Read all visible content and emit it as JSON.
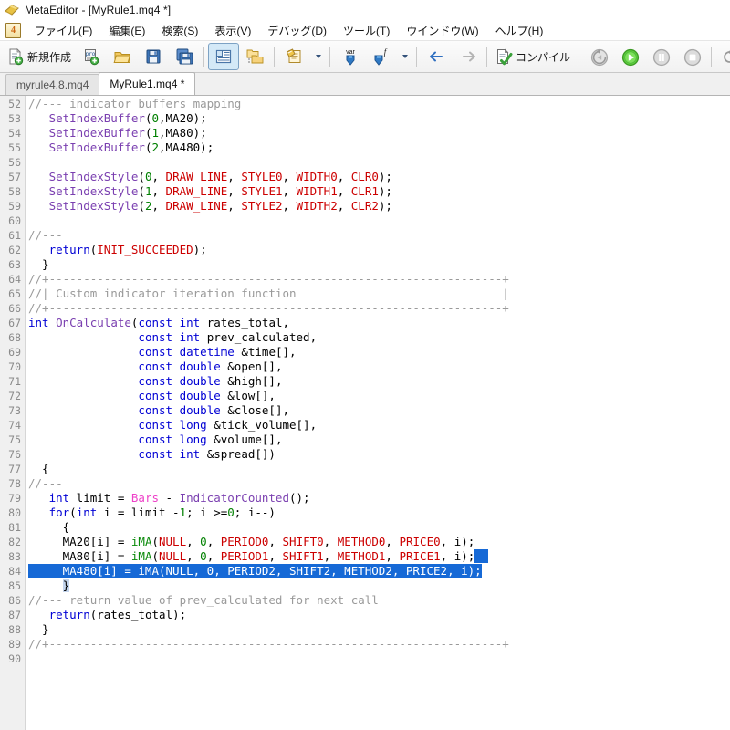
{
  "window": {
    "title": "MetaEditor - [MyRule1.mq4 *]",
    "icon": "metaeditor-logo-icon"
  },
  "menubar": {
    "logo_glyph": "4",
    "items": [
      {
        "label": "ファイル(F)",
        "name": "menu-file"
      },
      {
        "label": "編集(E)",
        "name": "menu-edit"
      },
      {
        "label": "検索(S)",
        "name": "menu-search"
      },
      {
        "label": "表示(V)",
        "name": "menu-view"
      },
      {
        "label": "デバッグ(D)",
        "name": "menu-debug"
      },
      {
        "label": "ツール(T)",
        "name": "menu-tools"
      },
      {
        "label": "ウインドウ(W)",
        "name": "menu-window"
      },
      {
        "label": "ヘルプ(H)",
        "name": "menu-help"
      }
    ]
  },
  "toolbar": {
    "new_label": "新規作成",
    "compile_label": "コンパイル",
    "var_label": "var",
    "func_label": "f",
    "buttons": [
      "new-file-button",
      "create-project-button",
      "open-file-button",
      "save-button",
      "save-all-button",
      "navigator-toggle-button",
      "folders-button",
      "properties-button",
      "insert-variable-button",
      "insert-function-button",
      "navigate-back-button",
      "navigate-forward-button",
      "compile-button",
      "debug-history-button",
      "start-button",
      "pause-button",
      "stop-button",
      "step-into-button",
      "step-over-button",
      "step-out-button"
    ]
  },
  "tabs": [
    {
      "label": "myrule4.8.mq4",
      "active": false,
      "name": "tab-myrule48"
    },
    {
      "label": "MyRule1.mq4 *",
      "active": true,
      "name": "tab-myrule1"
    }
  ],
  "editor": {
    "first_line": 52,
    "last_line": 90,
    "selection_lines": [
      83,
      84
    ],
    "lines": [
      {
        "n": 52,
        "tokens": [
          {
            "t": "//--- indicator buffers mapping",
            "c": "t-cmt"
          }
        ]
      },
      {
        "n": 53,
        "tokens": [
          {
            "t": "   ",
            "c": "t-punct"
          },
          {
            "t": "SetIndexBuffer",
            "c": "t-fn"
          },
          {
            "t": "(",
            "c": "t-punct"
          },
          {
            "t": "0",
            "c": "t-num"
          },
          {
            "t": ",",
            "c": "t-punct"
          },
          {
            "t": "MA20",
            "c": "t-ident"
          },
          {
            "t": ");",
            "c": "t-punct"
          }
        ]
      },
      {
        "n": 54,
        "tokens": [
          {
            "t": "   ",
            "c": "t-punct"
          },
          {
            "t": "SetIndexBuffer",
            "c": "t-fn"
          },
          {
            "t": "(",
            "c": "t-punct"
          },
          {
            "t": "1",
            "c": "t-num"
          },
          {
            "t": ",",
            "c": "t-punct"
          },
          {
            "t": "MA80",
            "c": "t-ident"
          },
          {
            "t": ");",
            "c": "t-punct"
          }
        ]
      },
      {
        "n": 55,
        "tokens": [
          {
            "t": "   ",
            "c": "t-punct"
          },
          {
            "t": "SetIndexBuffer",
            "c": "t-fn"
          },
          {
            "t": "(",
            "c": "t-punct"
          },
          {
            "t": "2",
            "c": "t-num"
          },
          {
            "t": ",",
            "c": "t-punct"
          },
          {
            "t": "MA480",
            "c": "t-ident"
          },
          {
            "t": ");",
            "c": "t-punct"
          }
        ]
      },
      {
        "n": 56,
        "tokens": [
          {
            "t": "",
            "c": "t-punct"
          }
        ]
      },
      {
        "n": 57,
        "tokens": [
          {
            "t": "   ",
            "c": "t-punct"
          },
          {
            "t": "SetIndexStyle",
            "c": "t-fn"
          },
          {
            "t": "(",
            "c": "t-punct"
          },
          {
            "t": "0",
            "c": "t-num"
          },
          {
            "t": ", ",
            "c": "t-punct"
          },
          {
            "t": "DRAW_LINE",
            "c": "t-macro"
          },
          {
            "t": ", ",
            "c": "t-punct"
          },
          {
            "t": "STYLE0",
            "c": "t-macro"
          },
          {
            "t": ", ",
            "c": "t-punct"
          },
          {
            "t": "WIDTH0",
            "c": "t-macro"
          },
          {
            "t": ", ",
            "c": "t-punct"
          },
          {
            "t": "CLR0",
            "c": "t-macro"
          },
          {
            "t": ");",
            "c": "t-punct"
          }
        ]
      },
      {
        "n": 58,
        "tokens": [
          {
            "t": "   ",
            "c": "t-punct"
          },
          {
            "t": "SetIndexStyle",
            "c": "t-fn"
          },
          {
            "t": "(",
            "c": "t-punct"
          },
          {
            "t": "1",
            "c": "t-num"
          },
          {
            "t": ", ",
            "c": "t-punct"
          },
          {
            "t": "DRAW_LINE",
            "c": "t-macro"
          },
          {
            "t": ", ",
            "c": "t-punct"
          },
          {
            "t": "STYLE1",
            "c": "t-macro"
          },
          {
            "t": ", ",
            "c": "t-punct"
          },
          {
            "t": "WIDTH1",
            "c": "t-macro"
          },
          {
            "t": ", ",
            "c": "t-punct"
          },
          {
            "t": "CLR1",
            "c": "t-macro"
          },
          {
            "t": ");",
            "c": "t-punct"
          }
        ]
      },
      {
        "n": 59,
        "tokens": [
          {
            "t": "   ",
            "c": "t-punct"
          },
          {
            "t": "SetIndexStyle",
            "c": "t-fn"
          },
          {
            "t": "(",
            "c": "t-punct"
          },
          {
            "t": "2",
            "c": "t-num"
          },
          {
            "t": ", ",
            "c": "t-punct"
          },
          {
            "t": "DRAW_LINE",
            "c": "t-macro"
          },
          {
            "t": ", ",
            "c": "t-punct"
          },
          {
            "t": "STYLE2",
            "c": "t-macro"
          },
          {
            "t": ", ",
            "c": "t-punct"
          },
          {
            "t": "WIDTH2",
            "c": "t-macro"
          },
          {
            "t": ", ",
            "c": "t-punct"
          },
          {
            "t": "CLR2",
            "c": "t-macro"
          },
          {
            "t": ");",
            "c": "t-punct"
          }
        ]
      },
      {
        "n": 60,
        "tokens": [
          {
            "t": "",
            "c": "t-punct"
          }
        ]
      },
      {
        "n": 61,
        "tokens": [
          {
            "t": "//---",
            "c": "t-cmt"
          }
        ]
      },
      {
        "n": 62,
        "tokens": [
          {
            "t": "   ",
            "c": "t-punct"
          },
          {
            "t": "return",
            "c": "t-kw"
          },
          {
            "t": "(",
            "c": "t-punct"
          },
          {
            "t": "INIT_SUCCEEDED",
            "c": "t-macro"
          },
          {
            "t": ");",
            "c": "t-punct"
          }
        ]
      },
      {
        "n": 63,
        "tokens": [
          {
            "t": "  }",
            "c": "t-punct"
          }
        ]
      },
      {
        "n": 64,
        "tokens": [
          {
            "t": "//+------------------------------------------------------------------+",
            "c": "t-cmt"
          }
        ]
      },
      {
        "n": 65,
        "tokens": [
          {
            "t": "//| Custom indicator iteration function                              |",
            "c": "t-cmt"
          }
        ]
      },
      {
        "n": 66,
        "tokens": [
          {
            "t": "//+------------------------------------------------------------------+",
            "c": "t-cmt"
          }
        ]
      },
      {
        "n": 67,
        "tokens": [
          {
            "t": "int",
            "c": "t-kw"
          },
          {
            "t": " ",
            "c": "t-punct"
          },
          {
            "t": "OnCalculate",
            "c": "t-fn"
          },
          {
            "t": "(",
            "c": "t-punct"
          },
          {
            "t": "const",
            "c": "t-kw"
          },
          {
            "t": " ",
            "c": "t-punct"
          },
          {
            "t": "int",
            "c": "t-kw"
          },
          {
            "t": " rates_total,",
            "c": "t-punct"
          }
        ]
      },
      {
        "n": 68,
        "tokens": [
          {
            "t": "                ",
            "c": "t-punct"
          },
          {
            "t": "const",
            "c": "t-kw"
          },
          {
            "t": " ",
            "c": "t-punct"
          },
          {
            "t": "int",
            "c": "t-kw"
          },
          {
            "t": " prev_calculated,",
            "c": "t-punct"
          }
        ]
      },
      {
        "n": 69,
        "tokens": [
          {
            "t": "                ",
            "c": "t-punct"
          },
          {
            "t": "const",
            "c": "t-kw"
          },
          {
            "t": " ",
            "c": "t-punct"
          },
          {
            "t": "datetime",
            "c": "t-kw"
          },
          {
            "t": " &time[],",
            "c": "t-punct"
          }
        ]
      },
      {
        "n": 70,
        "tokens": [
          {
            "t": "                ",
            "c": "t-punct"
          },
          {
            "t": "const",
            "c": "t-kw"
          },
          {
            "t": " ",
            "c": "t-punct"
          },
          {
            "t": "double",
            "c": "t-kw"
          },
          {
            "t": " &open[],",
            "c": "t-punct"
          }
        ]
      },
      {
        "n": 71,
        "tokens": [
          {
            "t": "                ",
            "c": "t-punct"
          },
          {
            "t": "const",
            "c": "t-kw"
          },
          {
            "t": " ",
            "c": "t-punct"
          },
          {
            "t": "double",
            "c": "t-kw"
          },
          {
            "t": " &high[],",
            "c": "t-punct"
          }
        ]
      },
      {
        "n": 72,
        "tokens": [
          {
            "t": "                ",
            "c": "t-punct"
          },
          {
            "t": "const",
            "c": "t-kw"
          },
          {
            "t": " ",
            "c": "t-punct"
          },
          {
            "t": "double",
            "c": "t-kw"
          },
          {
            "t": " &low[],",
            "c": "t-punct"
          }
        ]
      },
      {
        "n": 73,
        "tokens": [
          {
            "t": "                ",
            "c": "t-punct"
          },
          {
            "t": "const",
            "c": "t-kw"
          },
          {
            "t": " ",
            "c": "t-punct"
          },
          {
            "t": "double",
            "c": "t-kw"
          },
          {
            "t": " &close[],",
            "c": "t-punct"
          }
        ]
      },
      {
        "n": 74,
        "tokens": [
          {
            "t": "                ",
            "c": "t-punct"
          },
          {
            "t": "const",
            "c": "t-kw"
          },
          {
            "t": " ",
            "c": "t-punct"
          },
          {
            "t": "long",
            "c": "t-kw"
          },
          {
            "t": " &tick_volume[],",
            "c": "t-punct"
          }
        ]
      },
      {
        "n": 75,
        "tokens": [
          {
            "t": "                ",
            "c": "t-punct"
          },
          {
            "t": "const",
            "c": "t-kw"
          },
          {
            "t": " ",
            "c": "t-punct"
          },
          {
            "t": "long",
            "c": "t-kw"
          },
          {
            "t": " &volume[],",
            "c": "t-punct"
          }
        ]
      },
      {
        "n": 76,
        "tokens": [
          {
            "t": "                ",
            "c": "t-punct"
          },
          {
            "t": "const",
            "c": "t-kw"
          },
          {
            "t": " ",
            "c": "t-punct"
          },
          {
            "t": "int",
            "c": "t-kw"
          },
          {
            "t": " &spread[])",
            "c": "t-punct"
          }
        ]
      },
      {
        "n": 77,
        "tokens": [
          {
            "t": "  {",
            "c": "t-punct"
          }
        ]
      },
      {
        "n": 78,
        "tokens": [
          {
            "t": "//---",
            "c": "t-cmt"
          }
        ]
      },
      {
        "n": 79,
        "tokens": [
          {
            "t": "   ",
            "c": "t-punct"
          },
          {
            "t": "int",
            "c": "t-kw"
          },
          {
            "t": " limit = ",
            "c": "t-punct"
          },
          {
            "t": "Bars",
            "c": "t-pink"
          },
          {
            "t": " - ",
            "c": "t-punct"
          },
          {
            "t": "IndicatorCounted",
            "c": "t-fn"
          },
          {
            "t": "();",
            "c": "t-punct"
          }
        ]
      },
      {
        "n": 80,
        "tokens": [
          {
            "t": "   ",
            "c": "t-punct"
          },
          {
            "t": "for",
            "c": "t-kw"
          },
          {
            "t": "(",
            "c": "t-punct"
          },
          {
            "t": "int",
            "c": "t-kw"
          },
          {
            "t": " i = limit -",
            "c": "t-punct"
          },
          {
            "t": "1",
            "c": "t-num"
          },
          {
            "t": "; i >=",
            "c": "t-punct"
          },
          {
            "t": "0",
            "c": "t-num"
          },
          {
            "t": "; i--)",
            "c": "t-punct"
          }
        ]
      },
      {
        "n": 81,
        "tokens": [
          {
            "t": "     {",
            "c": "t-punct"
          }
        ]
      },
      {
        "n": 82,
        "tokens": [
          {
            "t": "     MA20[i] = ",
            "c": "t-punct"
          },
          {
            "t": "iMA",
            "c": "t-green2"
          },
          {
            "t": "(",
            "c": "t-punct"
          },
          {
            "t": "NULL",
            "c": "t-macro"
          },
          {
            "t": ", ",
            "c": "t-punct"
          },
          {
            "t": "0",
            "c": "t-num"
          },
          {
            "t": ", ",
            "c": "t-punct"
          },
          {
            "t": "PERIOD0",
            "c": "t-macro"
          },
          {
            "t": ", ",
            "c": "t-punct"
          },
          {
            "t": "SHIFT0",
            "c": "t-macro"
          },
          {
            "t": ", ",
            "c": "t-punct"
          },
          {
            "t": "METHOD0",
            "c": "t-macro"
          },
          {
            "t": ", ",
            "c": "t-punct"
          },
          {
            "t": "PRICE0",
            "c": "t-macro"
          },
          {
            "t": ", i);",
            "c": "t-punct"
          }
        ]
      },
      {
        "n": 83,
        "tokens": [
          {
            "t": "     MA80[i] = ",
            "c": "t-punct"
          },
          {
            "t": "iMA",
            "c": "t-green2"
          },
          {
            "t": "(",
            "c": "t-punct"
          },
          {
            "t": "NULL",
            "c": "t-macro"
          },
          {
            "t": ", ",
            "c": "t-punct"
          },
          {
            "t": "0",
            "c": "t-num"
          },
          {
            "t": ", ",
            "c": "t-punct"
          },
          {
            "t": "PERIOD1",
            "c": "t-macro"
          },
          {
            "t": ", ",
            "c": "t-punct"
          },
          {
            "t": "SHIFT1",
            "c": "t-macro"
          },
          {
            "t": ", ",
            "c": "t-punct"
          },
          {
            "t": "METHOD1",
            "c": "t-macro"
          },
          {
            "t": ", ",
            "c": "t-punct"
          },
          {
            "t": "PRICE1",
            "c": "t-macro"
          },
          {
            "t": ", i);",
            "c": "t-punct"
          }
        ]
      },
      {
        "n": 84,
        "tokens": [
          {
            "t": "     MA480[i] = iMA(NULL, 0, PERIOD2, SHIFT2, METHOD2, PRICE2, i);",
            "c": "t-punct"
          }
        ]
      },
      {
        "n": 85,
        "tokens": [
          {
            "t": "     }",
            "c": "t-punct"
          }
        ]
      },
      {
        "n": 86,
        "tokens": [
          {
            "t": "//--- return value of prev_calculated for next call",
            "c": "t-cmt"
          }
        ]
      },
      {
        "n": 87,
        "tokens": [
          {
            "t": "   ",
            "c": "t-punct"
          },
          {
            "t": "return",
            "c": "t-kw"
          },
          {
            "t": "(rates_total);",
            "c": "t-punct"
          }
        ]
      },
      {
        "n": 88,
        "tokens": [
          {
            "t": "  }",
            "c": "t-punct"
          }
        ]
      },
      {
        "n": 89,
        "tokens": [
          {
            "t": "//+------------------------------------------------------------------+",
            "c": "t-cmt"
          }
        ]
      },
      {
        "n": 90,
        "tokens": [
          {
            "t": "",
            "c": "t-punct"
          }
        ]
      }
    ]
  },
  "colors": {
    "selection": "#1669d6",
    "comment": "#9a9a9a",
    "keyword": "#0000d4",
    "function": "#7a3fb0",
    "macro": "#cc0000",
    "number": "#008000",
    "gutter_bg": "#f0f0f0"
  }
}
